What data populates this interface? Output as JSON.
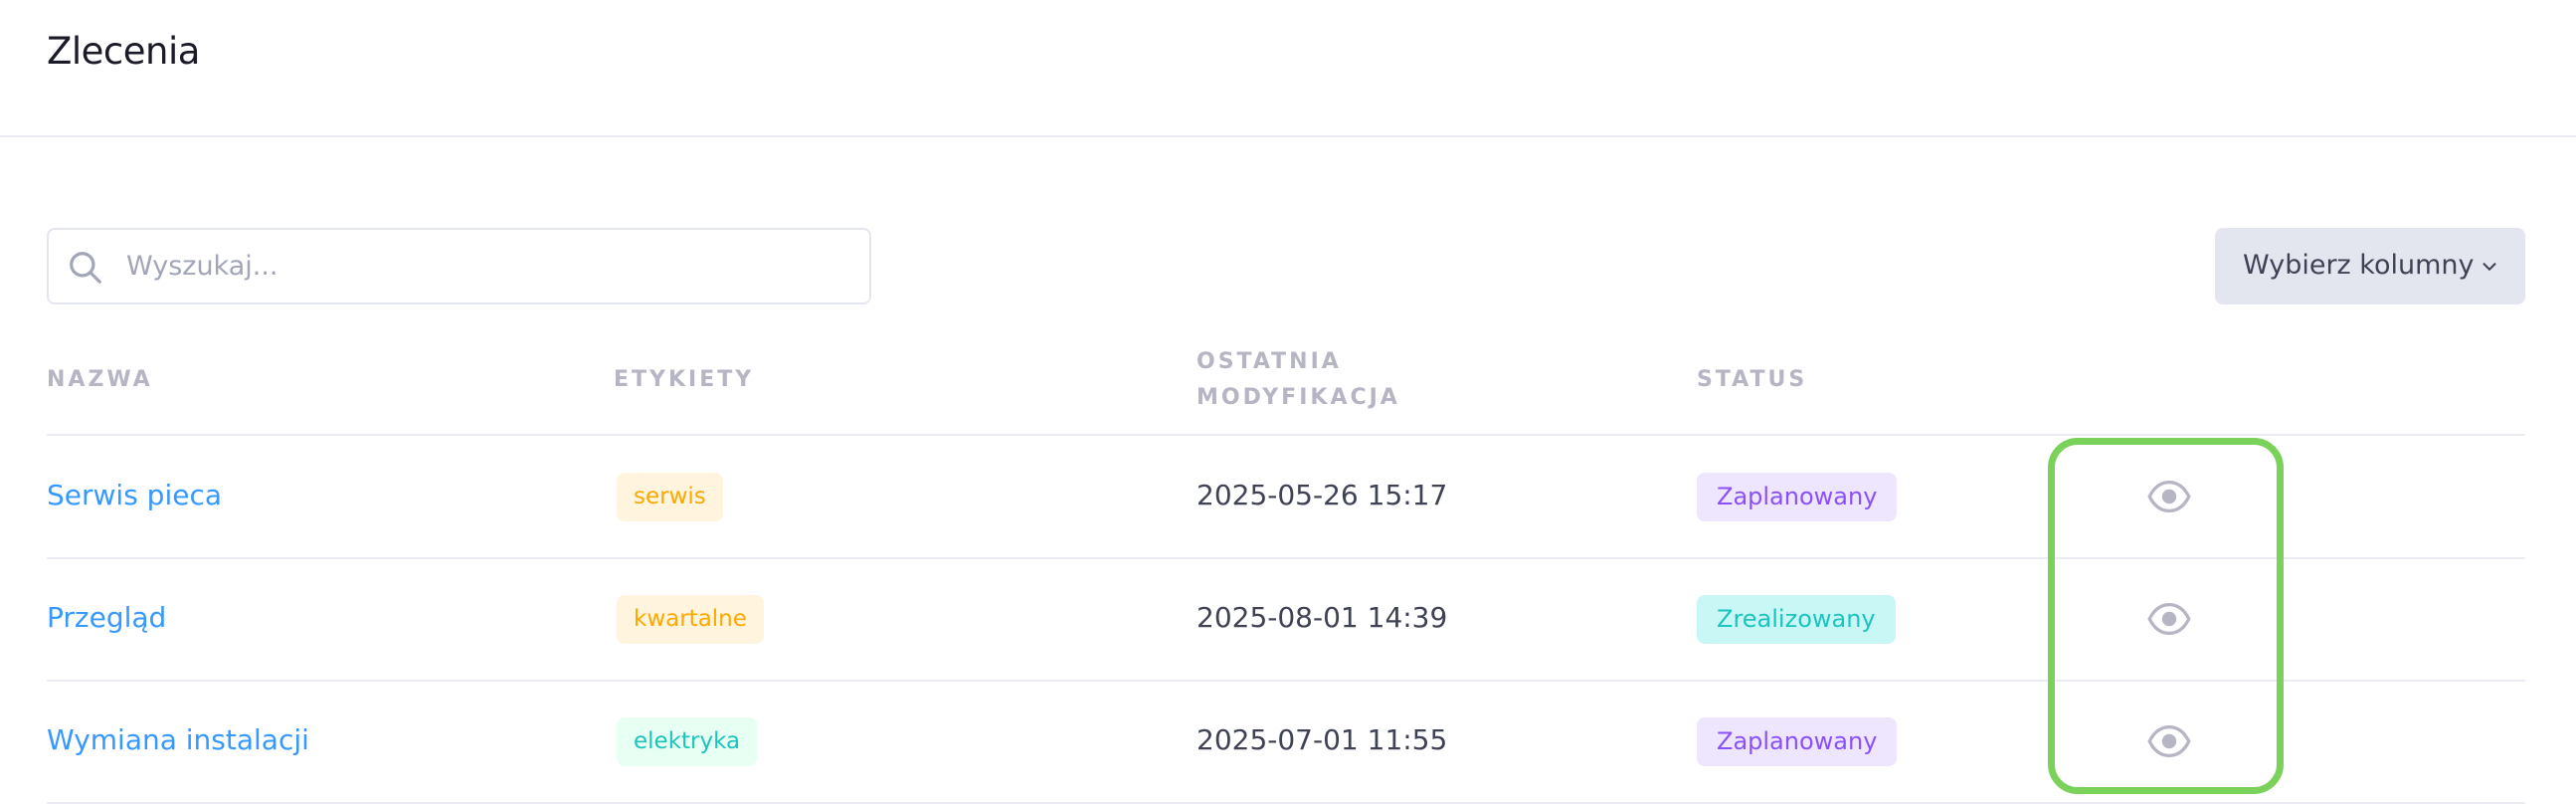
{
  "page": {
    "title": "Zlecenia"
  },
  "toolbar": {
    "search_placeholder": "Wyszukaj...",
    "search_value": "",
    "search_icon": "search-icon",
    "columns_button_label": "Wybierz kolumny",
    "columns_button_icon": "chevron-down-icon"
  },
  "table": {
    "headers": {
      "name": "NAZWA",
      "tags": "ETYKIETY",
      "modified_line1": "OSTATNIA",
      "modified_line2": "MODYFIKACJA",
      "status": "STATUS"
    },
    "rows": [
      {
        "name": "Serwis pieca",
        "tag": "serwis",
        "tag_style": "warning",
        "modified": "2025-05-26 15:17",
        "status": "Zaplanowany",
        "status_style": "planned",
        "action_icon": "eye-icon"
      },
      {
        "name": "Przegląd",
        "tag": "kwartalne",
        "tag_style": "warning",
        "modified": "2025-08-01 14:39",
        "status": "Zrealizowany",
        "status_style": "done",
        "action_icon": "eye-icon"
      },
      {
        "name": "Wymiana instalacji",
        "tag": "elektryka",
        "tag_style": "success",
        "modified": "2025-07-01 11:55",
        "status": "Zaplanowany",
        "status_style": "planned",
        "action_icon": "eye-icon"
      }
    ]
  },
  "colors": {
    "link": "#3699ff",
    "tag_warning_bg": "#fff4de",
    "tag_warning_text": "#ffa800",
    "tag_success_bg": "#e8fff3",
    "tag_success_text": "#1bc5bd",
    "status_planned_bg": "#eee5ff",
    "status_planned_text": "#8950fc",
    "status_done_bg": "#c9f7f5",
    "status_done_text": "#1bc5bd",
    "highlight": "#7ad25a",
    "icon_muted": "#b5b5c3"
  }
}
